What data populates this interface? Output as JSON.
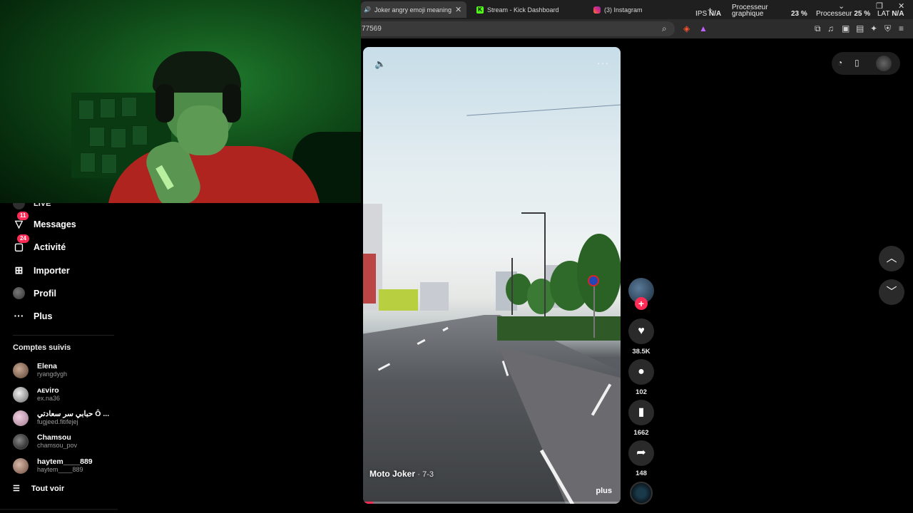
{
  "browser": {
    "tabs": [
      {
        "label": "Joker angry emoji meaning: …",
        "active": true,
        "icon": "speaker-icon"
      },
      {
        "label": "Stream - Kick Dashboard",
        "active": false,
        "icon": "kick-icon"
      },
      {
        "label": "(3) Instagram",
        "active": false,
        "icon": "instagram-icon"
      }
    ],
    "new_tab": "+",
    "stats": {
      "ips_label": "IPS",
      "ips_value": "N/A",
      "gpu_label_1": "Processeur",
      "gpu_label_2": "graphique",
      "gpu_value": "23 %",
      "cpu_label": "Processeur",
      "cpu_value": "25 %",
      "lat_label": "LAT",
      "lat_value": "N/A"
    },
    "url": "77569",
    "colors": {
      "tab_bar": "#1f1f1f",
      "address_bar": "#2c2c2c"
    }
  },
  "sidebar": {
    "partial_item": "LIVE",
    "items": [
      {
        "label": "Messages",
        "icon": "paper-plane-icon",
        "badge": "11"
      },
      {
        "label": "Activité",
        "icon": "chat-bubble-icon",
        "badge": "24"
      },
      {
        "label": "Importer",
        "icon": "plus-square-icon",
        "badge": ""
      },
      {
        "label": "Profil",
        "icon": "avatar-icon",
        "badge": ""
      },
      {
        "label": "Plus",
        "icon": "dots-icon",
        "badge": ""
      }
    ],
    "followed_title": "Comptes suivis",
    "followed": [
      {
        "name": "Elena",
        "username": "ryangdygh"
      },
      {
        "name": "ᴀᴇviro",
        "username": "ex.na36"
      },
      {
        "name": "حبابي سر سعادتي Ô ...",
        "username": "fugjeed.fitifejej"
      },
      {
        "name": "Chamsou",
        "username": "chamsou_pov"
      },
      {
        "name": "haytem____889",
        "username": "haytem____889"
      }
    ],
    "see_all": "Tout voir"
  },
  "video": {
    "author": "Moto Joker",
    "date": "· 7-3",
    "more_label": "plus",
    "progress": 0.04,
    "accent": "#fe2c55"
  },
  "actions": {
    "likes": "38.5K",
    "comments": "102",
    "saves": "1662",
    "shares": "148"
  }
}
